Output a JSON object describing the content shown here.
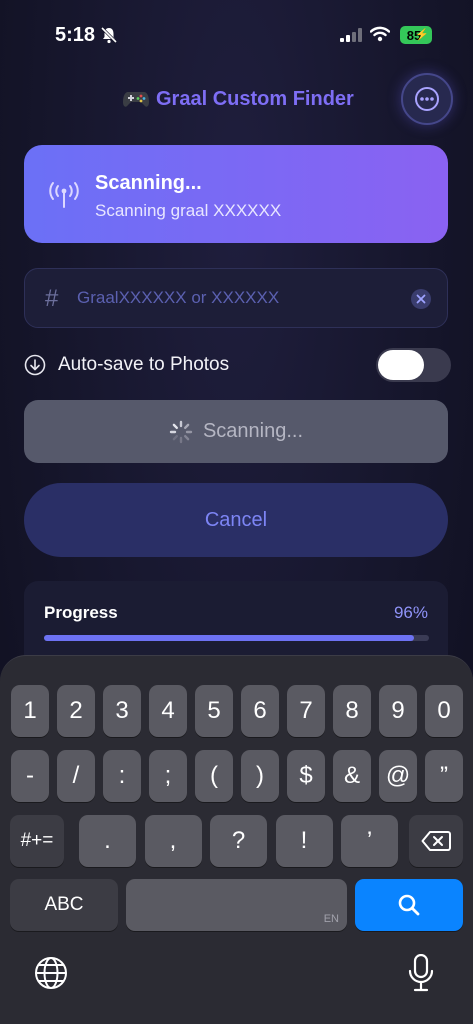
{
  "status_bar": {
    "time": "5:18",
    "battery": "85",
    "icons": [
      "bell-slash-icon",
      "signal-icon",
      "wifi-icon",
      "battery-icon"
    ]
  },
  "header": {
    "title": "Graal Custom Finder",
    "logo_icon": "gamepad-icon",
    "more_icon": "ellipsis-icon"
  },
  "banner": {
    "title": "Scanning...",
    "subtitle": "Scanning graal XXXXXX",
    "icon": "antenna-icon",
    "gradient": [
      "#6b70f6",
      "#8a62f2"
    ]
  },
  "search": {
    "prefix": "#",
    "value": "",
    "placeholder": "GraalXXXXXX or XXXXXX",
    "clear_icon": "clear-icon"
  },
  "autosave": {
    "label": "Auto-save to Photos",
    "icon": "download-icon",
    "enabled": true
  },
  "scan_button": {
    "label": "Scanning...",
    "icon": "spinner-icon"
  },
  "cancel_button": {
    "label": "Cancel"
  },
  "progress": {
    "label": "Progress",
    "value_text": "96%",
    "fraction": 0.96,
    "accent": "#6d72f3"
  },
  "keyboard": {
    "row1": [
      "1",
      "2",
      "3",
      "4",
      "5",
      "6",
      "7",
      "8",
      "9",
      "0"
    ],
    "row2": [
      "-",
      "/",
      ":",
      ";",
      "(",
      ")",
      "$",
      "&",
      "@",
      "”"
    ],
    "row3_mode": "#+=",
    "row3": [
      ".",
      ",",
      "?",
      "!",
      "’"
    ],
    "delete_icon": "backspace-icon",
    "abc": "ABC",
    "space_lang": "EN",
    "search_icon": "search-icon",
    "globe_icon": "globe-icon",
    "mic_icon": "microphone-icon",
    "action_color": "#0a84ff"
  }
}
